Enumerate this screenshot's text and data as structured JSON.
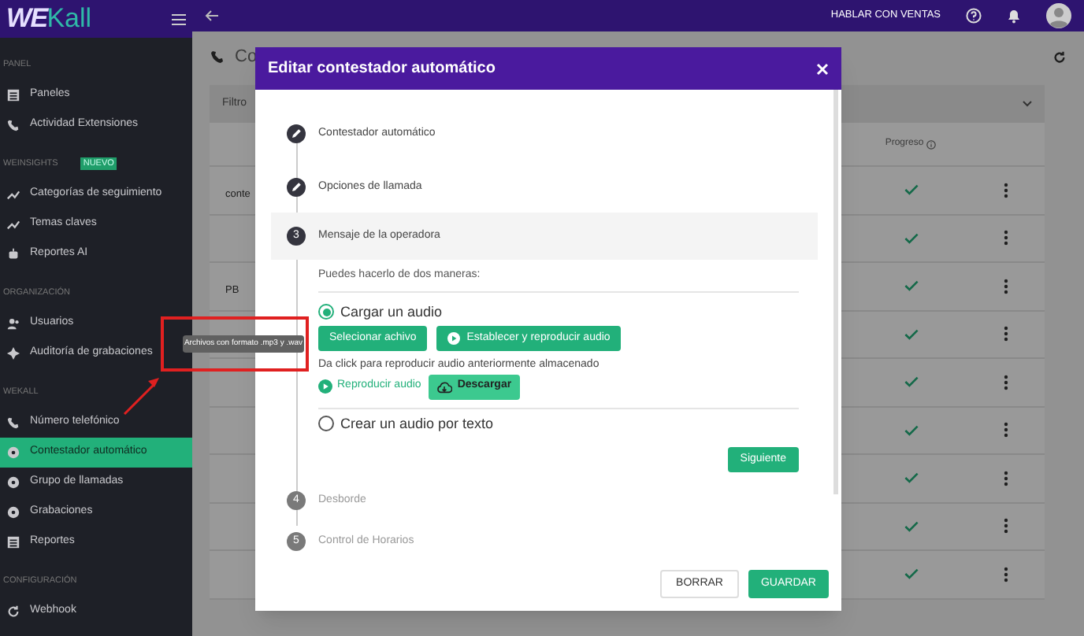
{
  "brand": {
    "logo_main": "WE",
    "logo_accent": "Kall"
  },
  "top_bar": {
    "sales_link": "HABLAR CON VENTAS"
  },
  "sidebar": {
    "sections": [
      {
        "heading": "PANEL",
        "items": [
          {
            "label": "Paneles",
            "selected": false
          },
          {
            "label": "Actividad Extensiones",
            "selected": false
          }
        ]
      },
      {
        "heading": "WEINSIGHTS",
        "badge": "NUEVO",
        "items": [
          {
            "label": "Categorías de seguimiento",
            "selected": false
          },
          {
            "label": "Temas claves",
            "selected": false
          },
          {
            "label": "Reportes AI",
            "selected": false
          }
        ]
      },
      {
        "heading": "ORGANIZACIÓN",
        "items": [
          {
            "label": "Usuarios",
            "selected": false
          },
          {
            "label": "Auditoría de grabaciones",
            "selected": false
          }
        ]
      },
      {
        "heading": "WEKALL",
        "items": [
          {
            "label": "Número telefónico",
            "selected": false
          },
          {
            "label": "Contestador automático",
            "selected": true
          },
          {
            "label": "Grupo de llamadas",
            "selected": false
          },
          {
            "label": "Grabaciones",
            "selected": false
          },
          {
            "label": "Reportes",
            "selected": false
          }
        ]
      },
      {
        "heading": "CONFIGURACIÓN",
        "items": [
          {
            "label": "Webhook",
            "selected": false
          }
        ]
      }
    ]
  },
  "page": {
    "title": "Co",
    "filter": "Filtro",
    "progress_column": "Progreso",
    "rows": [
      {
        "column_1": "conte",
        "done": true
      },
      {
        "done": true
      },
      {
        "column_1": "PB",
        "done": true
      },
      {
        "done": true
      },
      {
        "done": true
      },
      {
        "done": true
      },
      {
        "done": true
      },
      {
        "done": true
      },
      {
        "done": true
      }
    ]
  },
  "dialog": {
    "title": "Editar contestador automático",
    "steps": [
      {
        "kind": "done",
        "label": "Contestador automático"
      },
      {
        "kind": "done",
        "label": "Opciones de llamada"
      },
      {
        "kind": "active",
        "number": "3",
        "label": "Mensaje de la operadora"
      },
      {
        "kind": "pending",
        "number": "4",
        "label": "Desborde"
      },
      {
        "kind": "pending",
        "number": "5",
        "label": "Control de Horarios"
      }
    ],
    "hint": "Puedes hacerlo de dos maneras:",
    "options": [
      {
        "label": "Cargar un audio",
        "selected": true
      },
      {
        "label": "Crear un audio por texto",
        "selected": false
      }
    ],
    "select_file": "Selecionar achivo",
    "set_play": "Establecer y reproducir audio",
    "note": "Da click para reproducir audio anteriormente almacenado",
    "play_link": "Reproducir audio",
    "download": "Descargar",
    "next": "Siguiente",
    "buttons": {
      "clear": "BORRAR",
      "save": "GUARDAR"
    }
  },
  "tooltip": "Archivos con formato .mp3 y .wav"
}
